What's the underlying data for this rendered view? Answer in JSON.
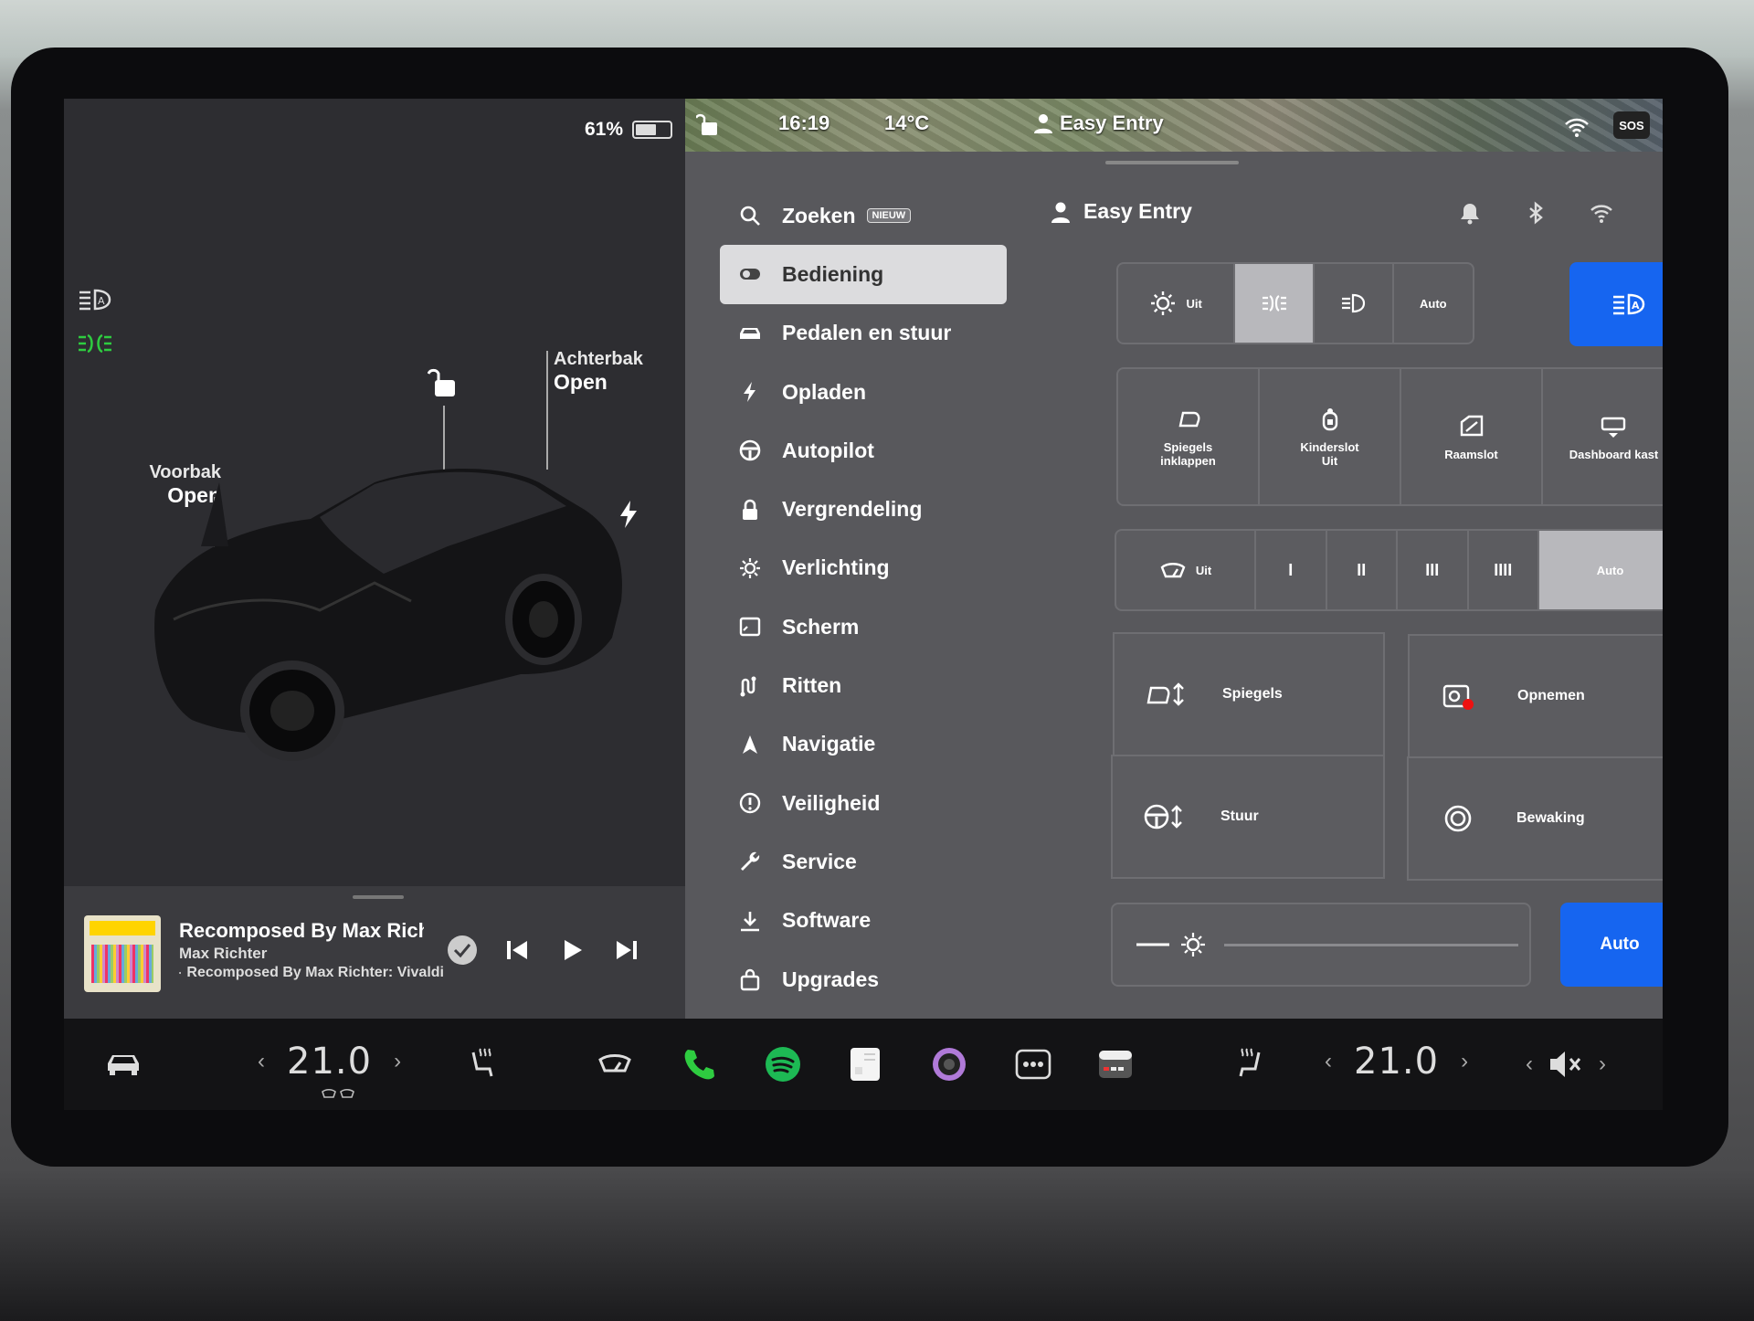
{
  "battery": {
    "percent_label": "61%",
    "level": 0.61
  },
  "vehicle": {
    "frunk_label": "Voorbak",
    "frunk_state": "Open",
    "trunk_label": "Achterbak",
    "trunk_state": "Open"
  },
  "media": {
    "title": "Recomposed By Max Richter: Vivaldi",
    "artist": "Max Richter",
    "source": "Recomposed By Max Richter: Vivaldi"
  },
  "status_bar": {
    "time": "16:19",
    "temperature": "14°C",
    "profile": "Easy Entry",
    "sos_label": "SOS"
  },
  "menu": {
    "search_label": "Zoeken",
    "search_badge": "NIEUW",
    "items": [
      {
        "label": "Bediening",
        "icon": "toggle-icon"
      },
      {
        "label": "Pedalen en stuur",
        "icon": "car-icon"
      },
      {
        "label": "Opladen",
        "icon": "bolt-icon"
      },
      {
        "label": "Autopilot",
        "icon": "steering-wheel-icon"
      },
      {
        "label": "Vergrendeling",
        "icon": "lock-icon"
      },
      {
        "label": "Verlichting",
        "icon": "sun-icon"
      },
      {
        "label": "Scherm",
        "icon": "display-icon"
      },
      {
        "label": "Ritten",
        "icon": "trips-icon"
      },
      {
        "label": "Navigatie",
        "icon": "navigation-icon"
      },
      {
        "label": "Veiligheid",
        "icon": "alert-icon"
      },
      {
        "label": "Service",
        "icon": "wrench-icon"
      },
      {
        "label": "Software",
        "icon": "download-icon"
      },
      {
        "label": "Upgrades",
        "icon": "bag-icon"
      }
    ]
  },
  "controls": {
    "profile_name": "Easy Entry",
    "lights": {
      "off_label": "Uit",
      "auto_label": "Auto"
    },
    "quick": [
      {
        "line1": "Spiegels",
        "line2": "inklappen"
      },
      {
        "line1": "Kinderslot",
        "line2": "Uit"
      },
      {
        "line1": "Raamslot",
        "line2": ""
      },
      {
        "line1": "Dashboard kast",
        "line2": ""
      }
    ],
    "wipers": {
      "off_label": "Uit",
      "speeds": [
        "I",
        "II",
        "III",
        "IIII"
      ],
      "auto_label": "Auto"
    },
    "mirrors_label": "Spiegels",
    "steering_label": "Stuur",
    "record_label": "Opnemen",
    "sentry_label": "Bewaking",
    "brightness_auto_label": "Auto",
    "brightness_level": 0.0
  },
  "dock": {
    "driver_temp": "21.0",
    "passenger_temp": "21.0"
  },
  "colors": {
    "accent": "#1665f0",
    "green": "#2ecc40",
    "spotify": "#1db954"
  }
}
